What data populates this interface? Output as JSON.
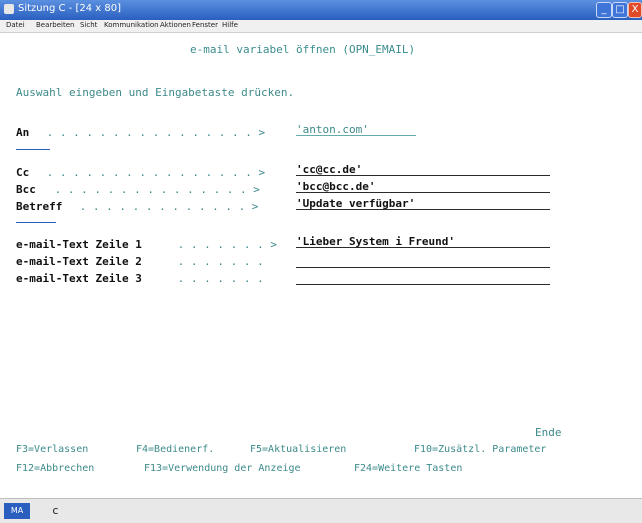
{
  "window": {
    "title": "Sitzung C - [24 x 80]",
    "buttons": {
      "minimize": "_",
      "maximize": "□",
      "close": "X"
    }
  },
  "menu": [
    "Datei",
    "Bearbeiten",
    "Sicht",
    "Kommunikation",
    "Aktionen",
    "Fenster",
    "Hilfe"
  ],
  "screen": {
    "header": "e-mail variabel öffnen (OPN_EMAIL)",
    "instruction": "Auswahl eingeben und Eingabetaste drücken.",
    "fields": [
      {
        "label": "An",
        "dots": " . . . . . . . . . . . . . . . . >",
        "value": "'anton.com'"
      },
      {
        "label": "Cc",
        "dots": " . . . . . . . . . . . . . . . . >",
        "value": "'cc@cc.de'"
      },
      {
        "label": "Bcc",
        "dots": " . . . . . . . . . . . . . . . >",
        "value": "'bcc@bcc.de'"
      },
      {
        "label": "Betreff",
        "dots": " . . . . . . . . . . . . . >",
        "value": "'Update verfügbar'"
      },
      {
        "label": "e-mail-Text Zeile 1",
        "dots": " . . . . . . . >",
        "value": "'Lieber System i Freund'"
      },
      {
        "label": "e-mail-Text Zeile 2",
        "dots": " . . . . . . .",
        "value": ""
      },
      {
        "label": "e-mail-Text Zeile 3",
        "dots": " . . . . . . .",
        "value": ""
      }
    ],
    "end_label": "Ende",
    "function_keys_row1": [
      "F3=Verlassen",
      "F4=Bedienerf.",
      "F5=Aktualisieren",
      "F10=Zusätzl. Parameter"
    ],
    "function_keys_row2": [
      "F12=Abbrechen",
      "F13=Verwendung der Anzeige",
      "F24=Weitere Tasten"
    ]
  },
  "status": {
    "session": "MA",
    "text": "c"
  },
  "colors": {
    "titlebar": "#2a5fc0",
    "green_text": "#3d8a8a",
    "field_text": "#111111"
  }
}
